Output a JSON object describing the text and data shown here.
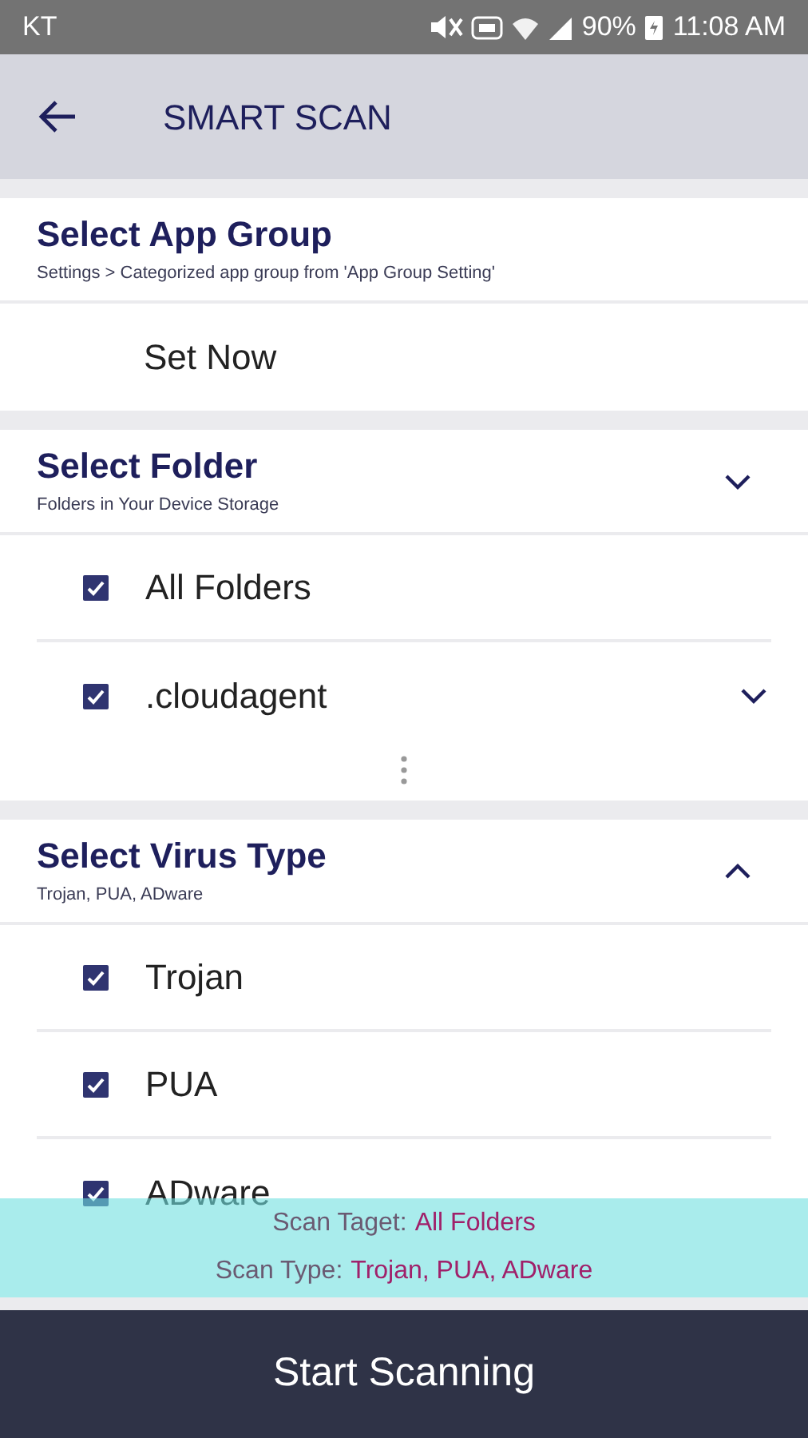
{
  "status_bar": {
    "carrier": "KT",
    "battery": "90%",
    "time": "11:08 AM"
  },
  "header": {
    "title": "SMART SCAN"
  },
  "app_group": {
    "title": "Select App Group",
    "subtitle": "Settings > Categorized app group from 'App Group Setting'",
    "action": "Set Now"
  },
  "folder_section": {
    "title": "Select Folder",
    "subtitle": "Folders in Your Device Storage",
    "expanded": false,
    "items": [
      {
        "label": "All Folders",
        "checked": true,
        "has_chevron": false
      },
      {
        "label": ".cloudagent",
        "checked": true,
        "has_chevron": true
      }
    ],
    "has_more": true
  },
  "virus_section": {
    "title": "Select Virus Type",
    "subtitle": "Trojan, PUA, ADware",
    "expanded": true,
    "items": [
      {
        "label": "Trojan",
        "checked": true
      },
      {
        "label": "PUA",
        "checked": true
      },
      {
        "label": "ADware",
        "checked": true
      }
    ]
  },
  "summary": [
    {
      "label": "Scan Taget:",
      "value": "All Folders"
    },
    {
      "label": "Scan Type:",
      "value": "Trojan, PUA, ADware"
    }
  ],
  "start_button": "Start Scanning"
}
